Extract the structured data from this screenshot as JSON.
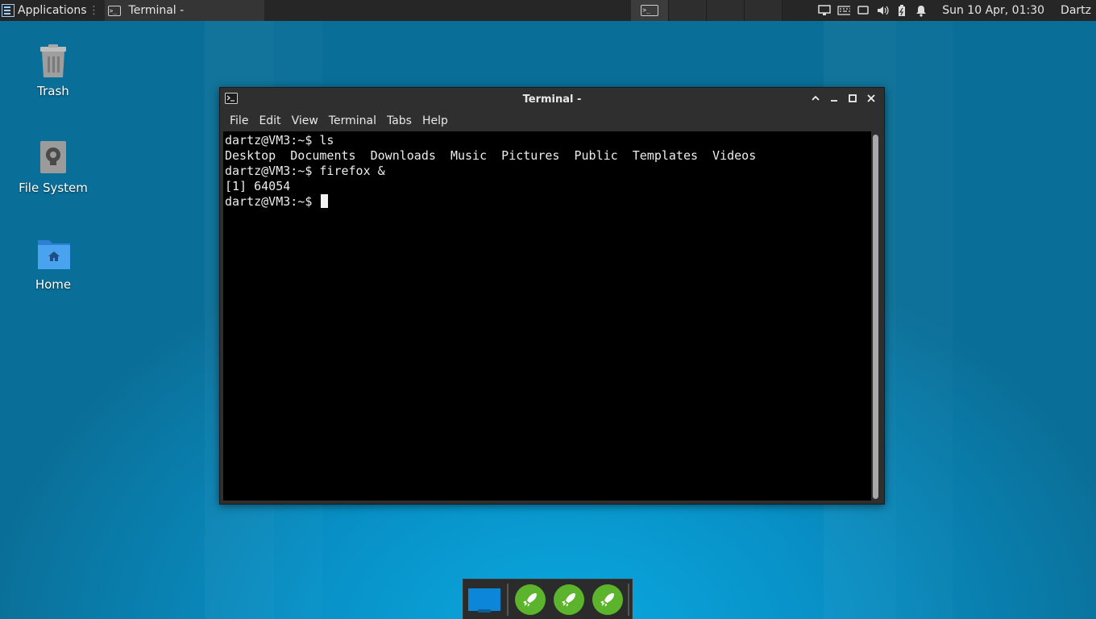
{
  "top_panel": {
    "applications_label": "Applications",
    "active_window_label": "Terminal -",
    "clock": "Sun 10 Apr, 01:30",
    "user": "Dartz",
    "tray_icons": [
      "network-icon",
      "keyboard-icon",
      "display-icon",
      "volume-icon",
      "battery-icon",
      "notification-bell-icon"
    ]
  },
  "desktop_icons": [
    {
      "label": "Trash",
      "icon": "trash-icon"
    },
    {
      "label": "File System",
      "icon": "drive-icon"
    },
    {
      "label": "Home",
      "icon": "home-folder-icon"
    }
  ],
  "window": {
    "title": "Terminal -",
    "menu": [
      "File",
      "Edit",
      "View",
      "Terminal",
      "Tabs",
      "Help"
    ],
    "terminal_lines": [
      "dartz@VM3:~$ ls",
      "Desktop  Documents  Downloads  Music  Pictures  Public  Templates  Videos",
      "dartz@VM3:~$ firefox &",
      "[1] 64054"
    ],
    "prompt": "dartz@VM3:~$ "
  },
  "dock": {
    "items": [
      "show-desktop-icon",
      "launcher-rocket-icon",
      "launcher-rocket-icon",
      "launcher-rocket-icon"
    ]
  },
  "colors": {
    "panel_bg": "#262626",
    "desktop_bg": "#0891c7",
    "terminal_bg": "#000000",
    "launcher_green": "#5cb42c"
  }
}
